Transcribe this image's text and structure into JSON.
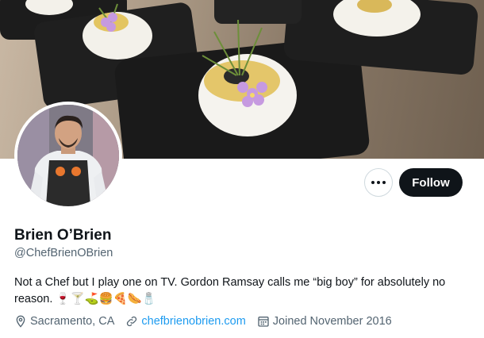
{
  "profile": {
    "name": "Brien O’Brien",
    "handle": "@ChefBrienOBrien",
    "bio": "Not a Chef but I play one on TV. Gordon Ramsay calls me “big boy” for absolutely no reason. 🍷🍸⛳🍔🍕🌭🧂",
    "location": "Sacramento, CA",
    "website": "chefbrienobrien.com",
    "joined": "Joined November 2016"
  },
  "actions": {
    "follow_label": "Follow"
  },
  "icons": {
    "more": "more-icon",
    "location": "location-pin-icon",
    "link": "link-icon",
    "calendar": "calendar-icon"
  },
  "colors": {
    "text_primary": "#0f1419",
    "text_secondary": "#536471",
    "link": "#1d9bf0",
    "follow_bg": "#0f1419"
  }
}
